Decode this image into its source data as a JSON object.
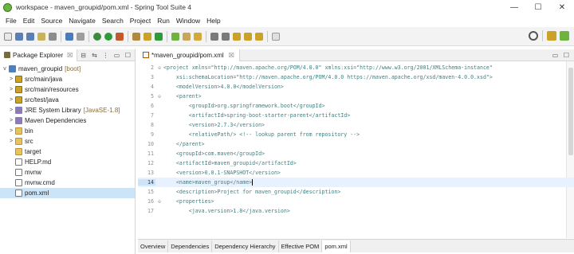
{
  "window": {
    "title": "workspace - maven_groupid/pom.xml - Spring Tool Suite 4",
    "controls": {
      "minimize": "—",
      "maximize": "☐",
      "close": "✕"
    }
  },
  "menu": [
    "File",
    "Edit",
    "Source",
    "Navigate",
    "Search",
    "Project",
    "Run",
    "Window",
    "Help"
  ],
  "explorer": {
    "tab_label": "Package Explorer",
    "tab_close": "☒",
    "tree": [
      {
        "label": "maven_groupid",
        "deco": "[boot]",
        "icon": "project-icon",
        "chevron": "v"
      },
      {
        "label": "src/main/java",
        "deco": "",
        "icon": "source-folder-icon",
        "chevron": ">"
      },
      {
        "label": "src/main/resources",
        "deco": "",
        "icon": "source-folder-icon",
        "chevron": ">"
      },
      {
        "label": "src/test/java",
        "deco": "",
        "icon": "source-folder-icon",
        "chevron": ">"
      },
      {
        "label": "JRE System Library",
        "deco": "[JavaSE-1.8]",
        "icon": "library-icon",
        "chevron": ">"
      },
      {
        "label": "Maven Dependencies",
        "deco": "",
        "icon": "library-icon",
        "chevron": ">"
      },
      {
        "label": "bin",
        "deco": "",
        "icon": "folder-icon",
        "chevron": ">"
      },
      {
        "label": "src",
        "deco": "",
        "icon": "folder-icon",
        "chevron": ">"
      },
      {
        "label": "target",
        "deco": "",
        "icon": "folder-icon",
        "chevron": ""
      },
      {
        "label": "HELP.md",
        "deco": "",
        "icon": "file-icon",
        "chevron": ""
      },
      {
        "label": "mvnw",
        "deco": "",
        "icon": "file-icon",
        "chevron": ""
      },
      {
        "label": "mvnw.cmd",
        "deco": "",
        "icon": "file-icon",
        "chevron": ""
      },
      {
        "label": "pom.xml",
        "deco": "",
        "icon": "xml-file-icon",
        "chevron": ""
      }
    ],
    "selected_index": 12
  },
  "editor": {
    "tab_label": "*maven_groupid/pom.xml",
    "tab_close": "☒",
    "current_line": 14,
    "lines": [
      {
        "num": "2",
        "fold": "⊖",
        "text": "<project xmlns=\"http://maven.apache.org/POM/4.0.0\" xmlns:xsi=\"http://www.w3.org/2001/XMLSchema-instance\""
      },
      {
        "num": "3",
        "fold": "",
        "text": "    xsi:schemaLocation=\"http://maven.apache.org/POM/4.0.0 https://maven.apache.org/xsd/maven-4.0.0.xsd\">"
      },
      {
        "num": "4",
        "fold": "",
        "text": "    <modelVersion>4.0.0</modelVersion>"
      },
      {
        "num": "5",
        "fold": "⊖",
        "text": "    <parent>"
      },
      {
        "num": "6",
        "fold": "",
        "text": "        <groupId>org.springframework.boot</groupId>"
      },
      {
        "num": "7",
        "fold": "",
        "text": "        <artifactId>spring-boot-starter-parent</artifactId>"
      },
      {
        "num": "8",
        "fold": "",
        "text": "        <version>2.7.3</version>"
      },
      {
        "num": "9",
        "fold": "",
        "text": "        <relativePath/> <!-- lookup parent from repository -->"
      },
      {
        "num": "10",
        "fold": "",
        "text": "    </parent>"
      },
      {
        "num": "11",
        "fold": "",
        "text": "    <groupId>com.maven</groupId>"
      },
      {
        "num": "12",
        "fold": "",
        "text": "    <artifactId>maven_groupid</artifactId>"
      },
      {
        "num": "13",
        "fold": "",
        "text": "    <version>0.0.1-SNAPSHOT</version>"
      },
      {
        "num": "14",
        "fold": "",
        "text": "    <name>maven_group</name>"
      },
      {
        "num": "15",
        "fold": "",
        "text": "    <description>Project for maven_groupid</description>"
      },
      {
        "num": "16",
        "fold": "⊖",
        "text": "    <properties>"
      },
      {
        "num": "17",
        "fold": "",
        "text": "        <java.version>1.8</java.version>"
      }
    ],
    "bottom_tabs": [
      "Overview",
      "Dependencies",
      "Dependency Hierarchy",
      "Effective POM",
      "pom.xml"
    ],
    "active_bottom_tab": 4
  }
}
